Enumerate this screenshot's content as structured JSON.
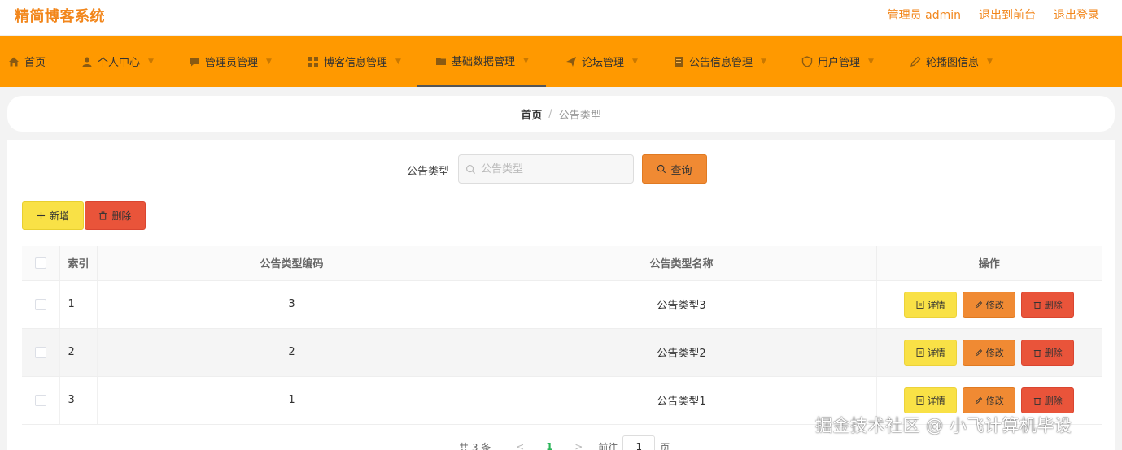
{
  "header": {
    "app_title": "精简博客系统",
    "links": [
      "管理员 admin",
      "退出到前台",
      "退出登录"
    ]
  },
  "nav": {
    "items": [
      {
        "label": "首页",
        "icon": "home-icon"
      },
      {
        "label": "个人中心",
        "icon": "user-icon"
      },
      {
        "label": "管理员管理",
        "icon": "chat-icon"
      },
      {
        "label": "博客信息管理",
        "icon": "grid-icon"
      },
      {
        "label": "基础数据管理",
        "icon": "folder-icon"
      },
      {
        "label": "论坛管理",
        "icon": "send-icon"
      },
      {
        "label": "公告信息管理",
        "icon": "document-icon"
      },
      {
        "label": "用户管理",
        "icon": "shield-icon"
      },
      {
        "label": "轮播图信息",
        "icon": "edit-icon"
      }
    ],
    "active_index": 4
  },
  "breadcrumb": {
    "home": "首页",
    "separator": "/",
    "current": "公告类型"
  },
  "search": {
    "label": "公告类型",
    "placeholder": "公告类型",
    "value": "",
    "button_label": "查询"
  },
  "toolbar": {
    "add_label": "新增",
    "delete_label": "删除"
  },
  "table": {
    "columns": [
      "索引",
      "公告类型编码",
      "公告类型名称",
      "操作"
    ],
    "rows": [
      {
        "index": "1",
        "code": "3",
        "name": "公告类型3"
      },
      {
        "index": "2",
        "code": "2",
        "name": "公告类型2"
      },
      {
        "index": "3",
        "code": "1",
        "name": "公告类型1"
      }
    ],
    "row_actions": {
      "detail": "详情",
      "edit": "修改",
      "delete": "删除"
    }
  },
  "pagination": {
    "total_text": "共 3 条",
    "prev": "<",
    "current_page": "1",
    "next": ">",
    "goto_label": "前往",
    "goto_value": "1",
    "page_suffix": "页"
  },
  "watermark": "掘金技术社区 @ 小飞计算机毕设",
  "colors": {
    "brand_orange": "#ff9900",
    "title_orange": "#f2861b",
    "yellow_button": "#f9e146",
    "orange_button": "#f08a33",
    "red_button": "#e9543a",
    "page_green": "#2bb55a"
  }
}
